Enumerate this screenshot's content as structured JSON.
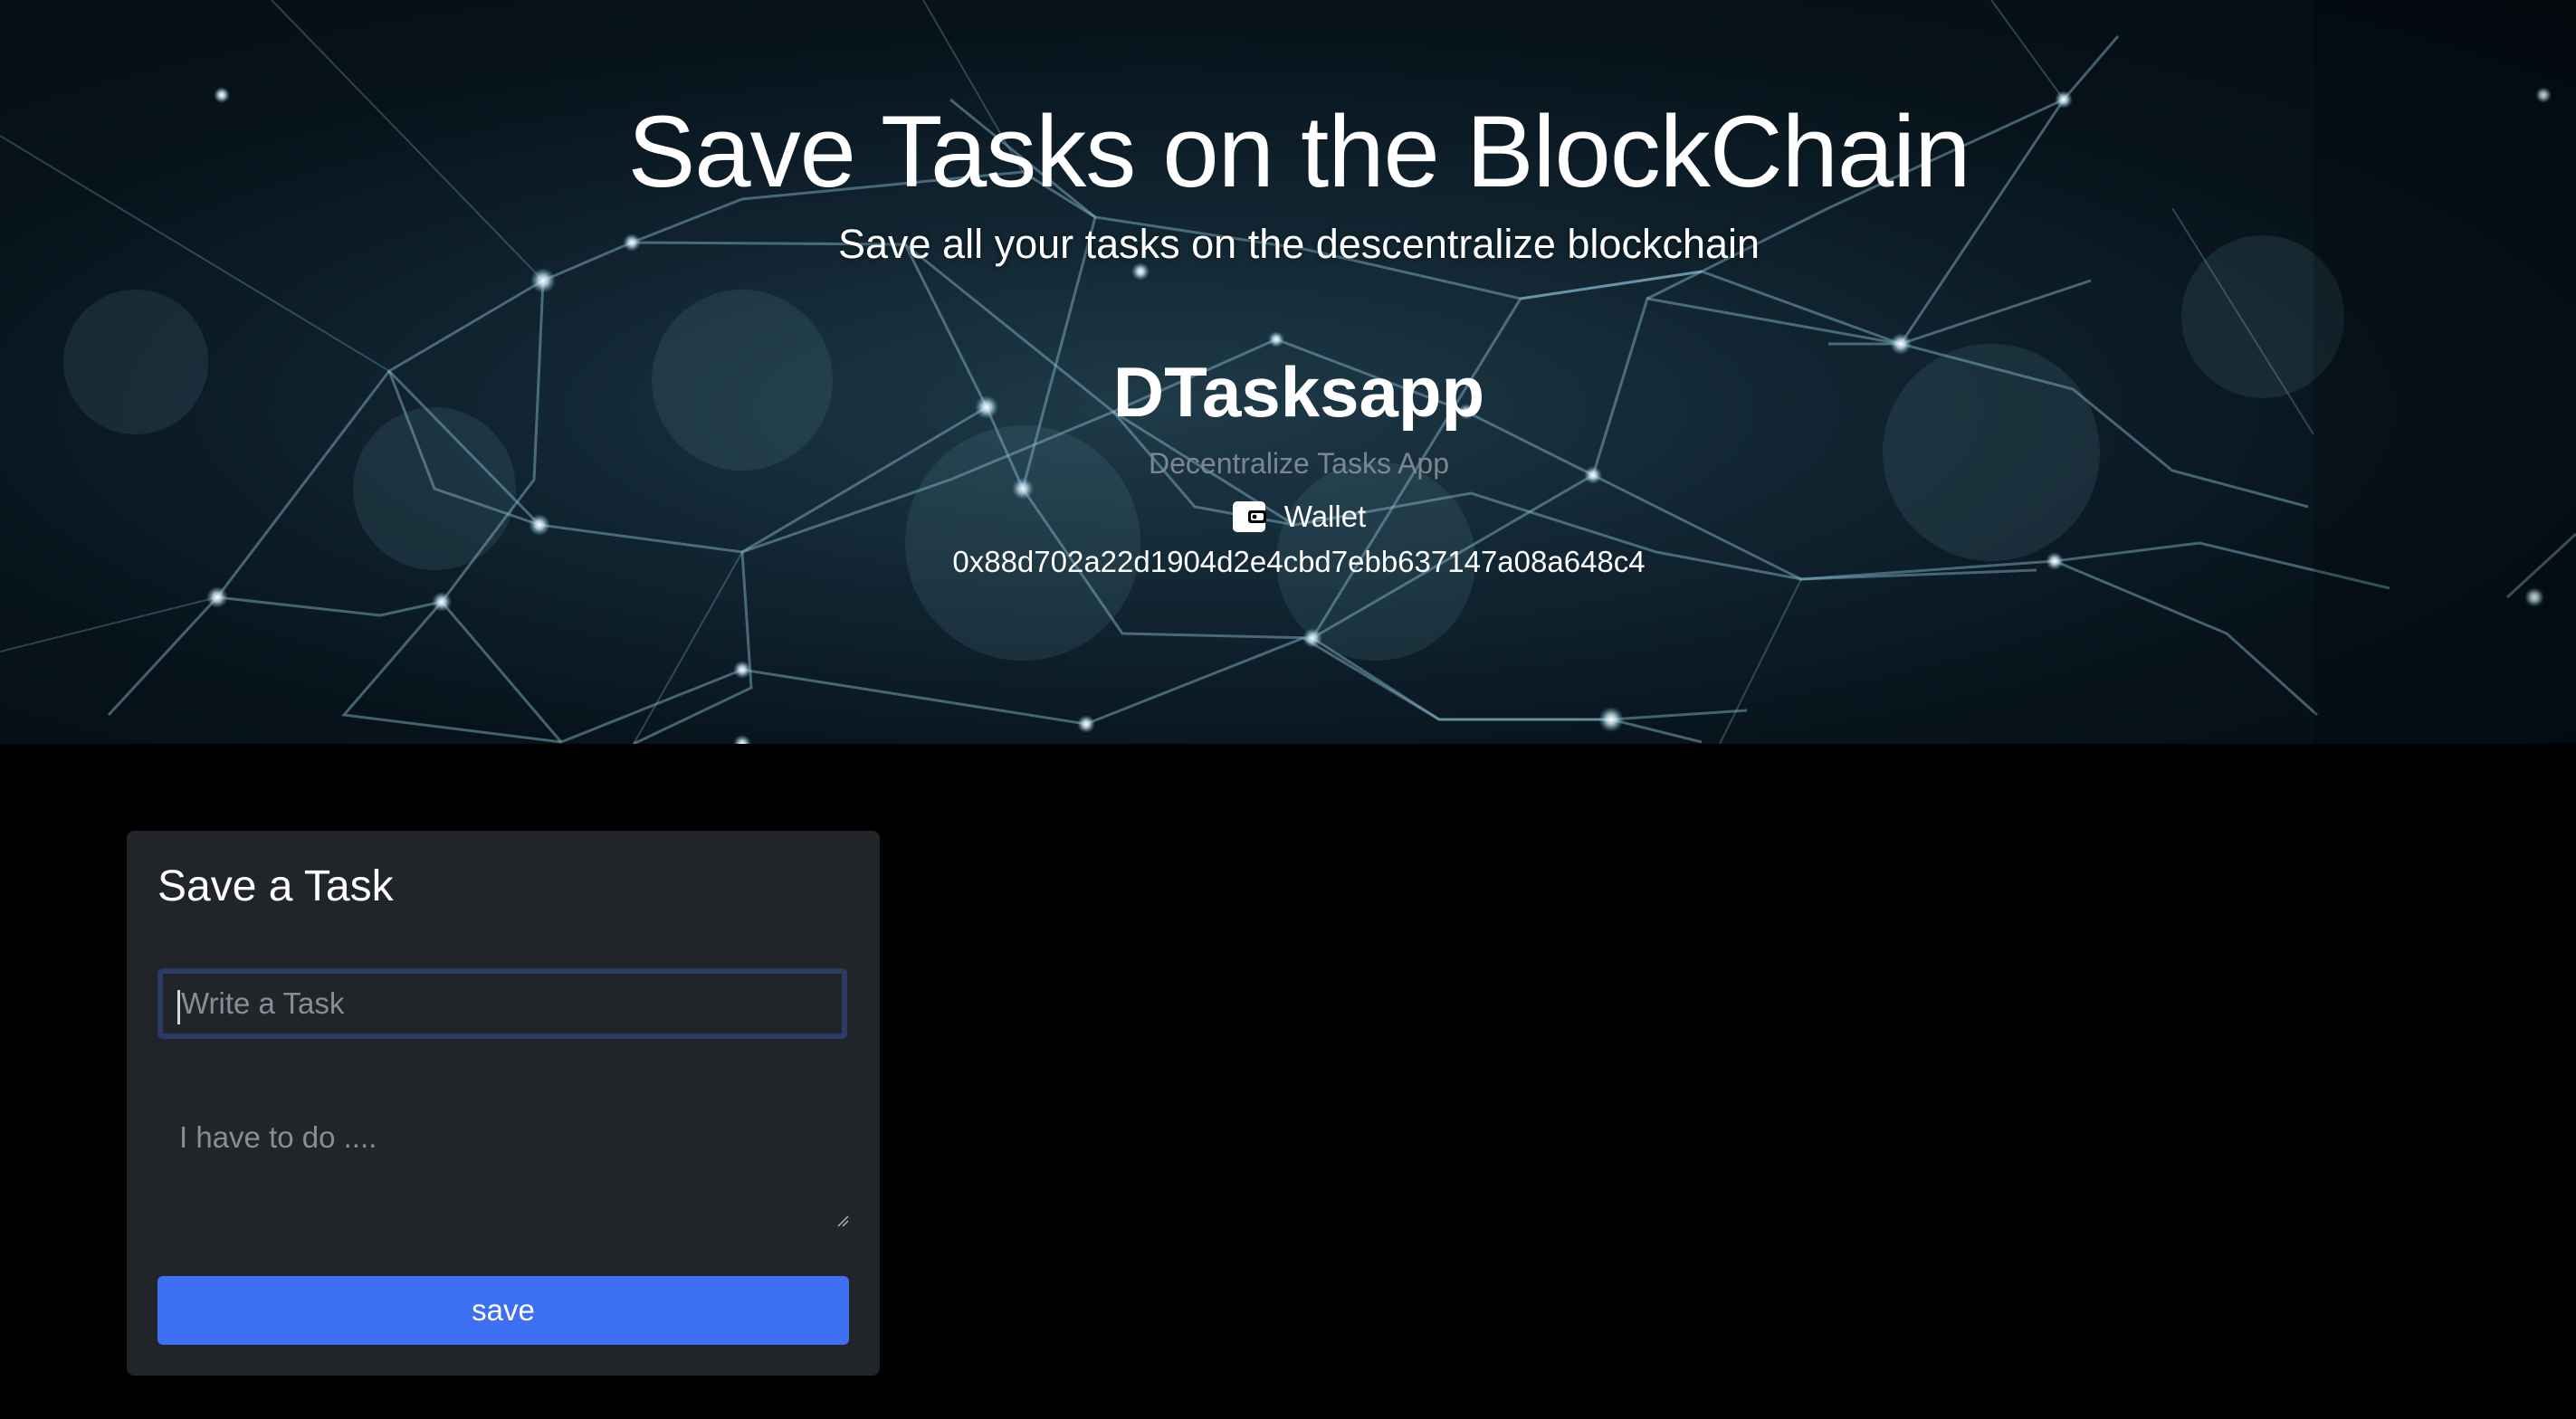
{
  "hero": {
    "title": "Save Tasks on the BlockChain",
    "subtitle": "Save all your tasks on the descentralize blockchain",
    "app_name": "DTasksapp",
    "tagline": "Decentralize Tasks App",
    "wallet_label": "Wallet",
    "wallet_icon": "wallet-icon",
    "wallet_address": "0x88d702a22d1904d2e4cbd7ebb637147a08a648c4"
  },
  "task_form": {
    "title": "Save a Task",
    "title_placeholder": "Write a Task",
    "description_placeholder": "I have to do ....",
    "save_label": "save"
  },
  "colors": {
    "background": "#000000",
    "card": "#212529",
    "primary_button": "#3d6ff2",
    "input_focus_border": "#2b3b66",
    "muted_text": "#7c8790"
  }
}
